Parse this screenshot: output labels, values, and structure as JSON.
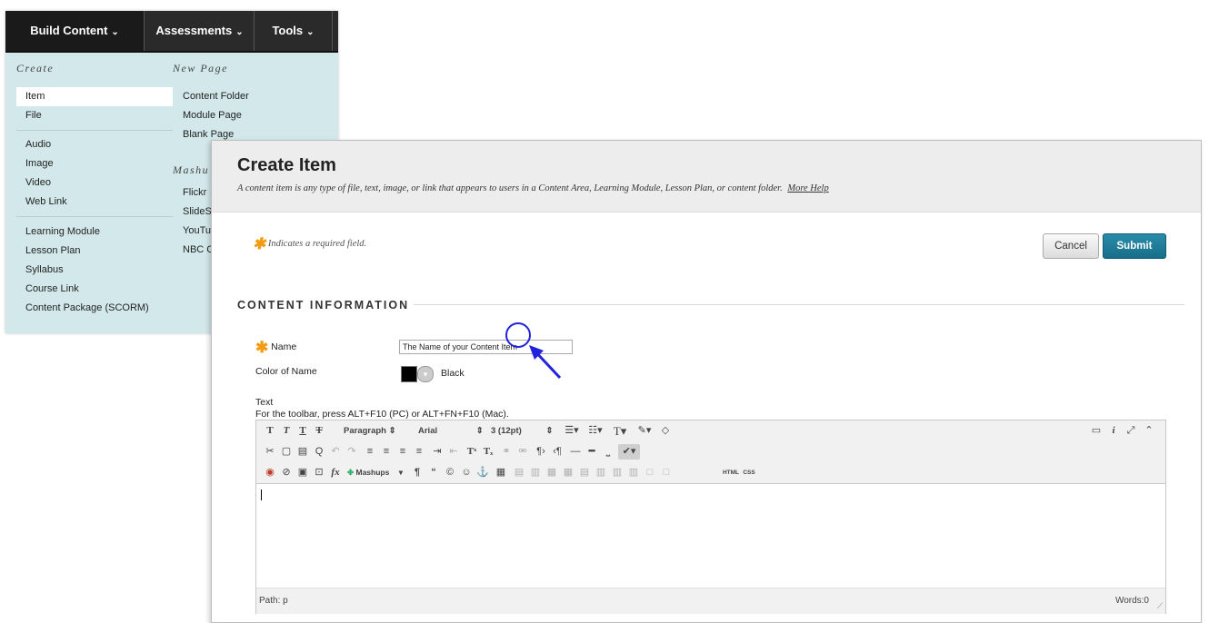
{
  "menu": {
    "tabs": [
      {
        "label": "Build Content"
      },
      {
        "label": "Assessments"
      },
      {
        "label": "Tools"
      }
    ],
    "chevron": "⌄",
    "create_heading": "Create",
    "new_page_heading": "New Page",
    "mashups_heading": "Mashu",
    "create_items": [
      "Item",
      "File",
      "Audio",
      "Image",
      "Video",
      "Web Link",
      "Learning Module",
      "Lesson Plan",
      "Syllabus",
      "Course Link",
      "Content Package (SCORM)"
    ],
    "new_page_items": [
      "Content Folder",
      "Module Page",
      "Blank Page"
    ],
    "mashup_items": [
      "Flickr",
      "SlideS",
      "YouTu",
      "NBC C"
    ],
    "selected_item": "Item"
  },
  "panel": {
    "title": "Create Item",
    "description": "A content item is any type of file, text, image, or link that appears to users in a Content Area, Learning Module, Lesson Plan, or content folder.",
    "more_help": "More Help",
    "required_note": "Indicates a required field.",
    "required_marker": "✱",
    "cancel_label": "Cancel",
    "submit_label": "Submit",
    "section_title": "CONTENT INFORMATION",
    "name_label": "Name",
    "name_value": "The Name of your Content Item",
    "color_label": "Color of Name",
    "color_value": "Black",
    "text_label": "Text",
    "toolbar_hint": "For the toolbar, press ALT+F10 (PC) or ALT+FN+F10 (Mac).",
    "paragraph_select": "Paragraph",
    "font_select": "Arial",
    "size_select": "3 (12pt)",
    "mashups_label": "Mashups",
    "html_label": "HTML",
    "css_label": "CSS",
    "path_label": "Path: p",
    "words_label": "Words:0"
  },
  "colors": {
    "menu_bg": "#d3e8ea",
    "tabbar": "#2a2a2a",
    "accent_submit": "#1f7f9c",
    "asterisk": "#f39c12",
    "annotation": "#2222dd"
  }
}
